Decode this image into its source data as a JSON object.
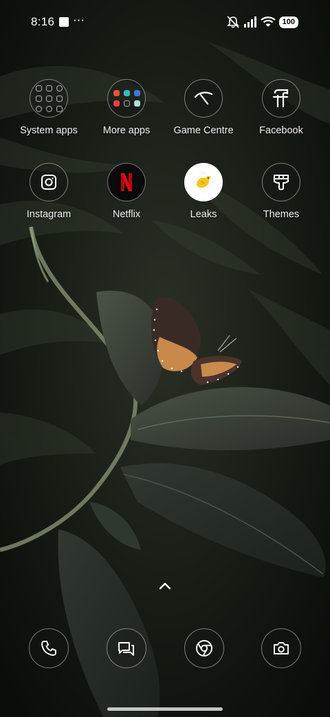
{
  "status_bar": {
    "time": "8:16",
    "extra_icons": "⋯",
    "battery": "100"
  },
  "apps": [
    {
      "label": "System apps"
    },
    {
      "label": "More apps"
    },
    {
      "label": "Game Centre"
    },
    {
      "label": "Facebook"
    },
    {
      "label": "Instagram"
    },
    {
      "label": "Netflix"
    },
    {
      "label": "Leaks"
    },
    {
      "label": "Themes"
    }
  ],
  "dock": [
    {
      "icon": "phone-icon"
    },
    {
      "icon": "messages-icon"
    },
    {
      "icon": "chrome-icon"
    },
    {
      "icon": "camera-icon"
    }
  ],
  "colors": {
    "background": "#0d110c",
    "icon_border": "rgba(255,255,255,0.45)",
    "netflix_red": "#e50914",
    "leaks_yellow": "#f3c623"
  }
}
